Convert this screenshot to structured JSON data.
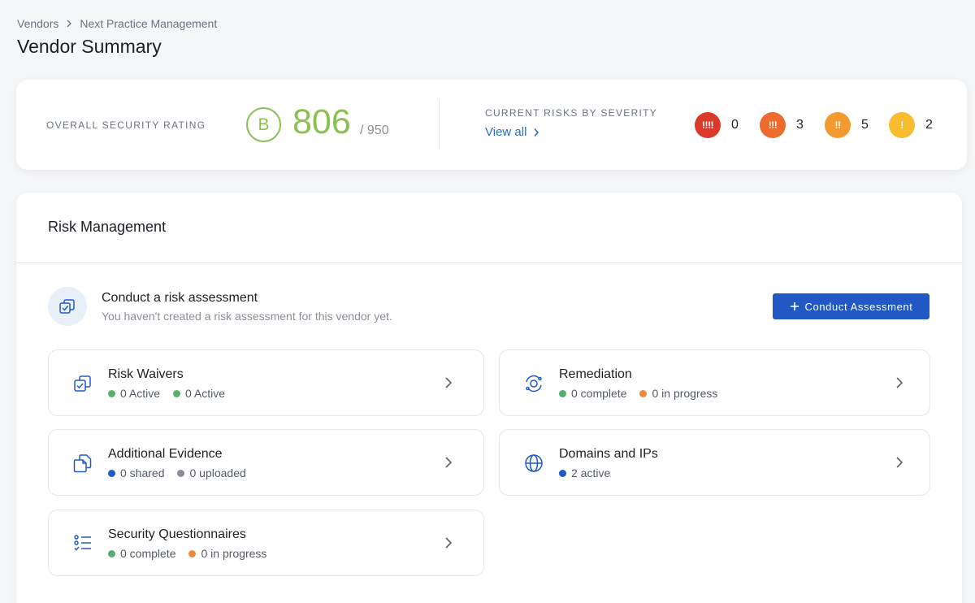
{
  "breadcrumb": {
    "parent": "Vendors",
    "current": "Next Practice Management"
  },
  "page_title": "Vendor Summary",
  "rating": {
    "label": "OVERALL SECURITY RATING",
    "grade": "B",
    "score": "806",
    "max": "/ 950",
    "color": "#8cc152"
  },
  "risks": {
    "label": "CURRENT RISKS BY SEVERITY",
    "view_all": "View all",
    "levels": [
      {
        "symbol": "!!!!",
        "count": "0",
        "color": "#d93a2b"
      },
      {
        "symbol": "!!!",
        "count": "3",
        "color": "#ec6b2d"
      },
      {
        "symbol": "!!",
        "count": "5",
        "color": "#f29a30"
      },
      {
        "symbol": "!",
        "count": "2",
        "color": "#f7bd2e"
      }
    ]
  },
  "risk_management": {
    "title": "Risk Management",
    "assessment": {
      "title": "Conduct a risk assessment",
      "subtitle": "You haven't created a risk assessment for this vendor yet.",
      "button": "Conduct Assessment"
    },
    "tiles": [
      {
        "title": "Risk Waivers",
        "icon": "waiver-icon",
        "stats": [
          {
            "text": "0 Active",
            "color": "#57ae6e"
          },
          {
            "text": "0 Active",
            "color": "#57ae6e"
          }
        ]
      },
      {
        "title": "Remediation",
        "icon": "remediation-icon",
        "stats": [
          {
            "text": "0 complete",
            "color": "#57ae6e"
          },
          {
            "text": "0 in progress",
            "color": "#ec8a3c"
          }
        ]
      },
      {
        "title": "Additional Evidence",
        "icon": "evidence-icon",
        "stats": [
          {
            "text": "0 shared",
            "color": "#2258c4"
          },
          {
            "text": "0 uploaded",
            "color": "#8a8f98"
          }
        ]
      },
      {
        "title": "Domains and IPs",
        "icon": "globe-icon",
        "stats": [
          {
            "text": "2 active",
            "color": "#2258c4"
          }
        ]
      },
      {
        "title": "Security Questionnaires",
        "icon": "questionnaire-icon",
        "stats": [
          {
            "text": "0 complete",
            "color": "#57ae6e"
          },
          {
            "text": "0 in progress",
            "color": "#ec8a3c"
          }
        ]
      }
    ]
  }
}
